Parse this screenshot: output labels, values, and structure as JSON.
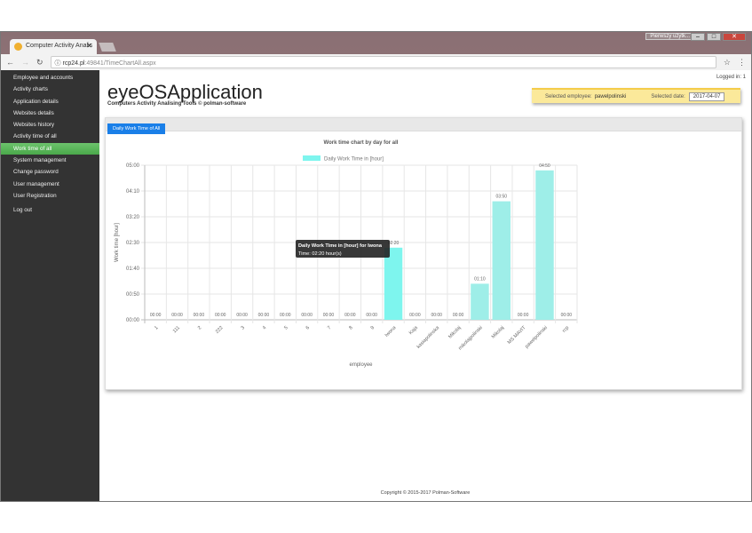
{
  "browser": {
    "tab_title": "Computer Activity Analis",
    "url_host": "rcp24.pl",
    "url_path": ":49841/TimeChartAll.aspx",
    "profile": "Pierwszy użytk..."
  },
  "sidebar": {
    "items": [
      {
        "label": "Employee and accounts"
      },
      {
        "label": "Activity charts"
      },
      {
        "label": "Application details"
      },
      {
        "label": "Websites details"
      },
      {
        "label": "Websites history"
      },
      {
        "label": "Activity time of all"
      },
      {
        "label": "Work time of all",
        "active": true
      },
      {
        "label": "System management"
      },
      {
        "label": "Change password"
      },
      {
        "label": "User management"
      },
      {
        "label": "User Registration"
      },
      {
        "label": "Log out"
      }
    ]
  },
  "header": {
    "logged_in": "Logged in: 1",
    "title": "eyeOSApplication",
    "subtitle": "Computers Activity Analising Tools © polman-software",
    "employee_label": "Selected employee:",
    "employee": "pawelpolinski",
    "date_label": "Selected date:",
    "date": "2017-04-07"
  },
  "panel": {
    "tab": "Daily Work Time of All"
  },
  "footer": "Copyright © 2015-2017 Polman-Software",
  "chart_data": {
    "type": "bar",
    "title": "Work time chart by day for all",
    "xlabel": "employee",
    "ylabel": "Work time [hour]",
    "legend": "Daily Work Time in [hour]",
    "legend_position": "top",
    "grid": true,
    "bar_color": "#7ef5ee",
    "y_ticks": [
      "00:00",
      "00:50",
      "01:40",
      "02:30",
      "03:20",
      "04:10",
      "05:00"
    ],
    "ylim": [
      0,
      5
    ],
    "categories": [
      "1",
      "111",
      "2",
      "222",
      "3",
      "4",
      "5",
      "6",
      "7",
      "8",
      "9",
      "Iwona",
      "Kaja",
      "kasiapolinska",
      "Mikolaj",
      "mikolajpolinski",
      "Mikolaj",
      "MS MAVIT",
      "pawelpolinski",
      "rcp"
    ],
    "values": [
      0,
      0,
      0,
      0,
      0,
      0,
      0,
      0,
      0,
      0,
      0,
      2.3333,
      0,
      0,
      0,
      1.1667,
      3.8333,
      0,
      4.8333,
      0
    ],
    "labels": [
      "00:00",
      "00:00",
      "00:00",
      "00:00",
      "00:00",
      "00:00",
      "00:00",
      "00:00",
      "00:00",
      "00:00",
      "00:00",
      "02:20",
      "00:00",
      "00:00",
      "00:00",
      "01:10",
      "03:50",
      "00:00",
      "04:50",
      "00:00"
    ],
    "tooltip": {
      "title": "Daily Work Time in [hour] for Iwona",
      "body": "Time: 02:20 hour(s)"
    }
  }
}
